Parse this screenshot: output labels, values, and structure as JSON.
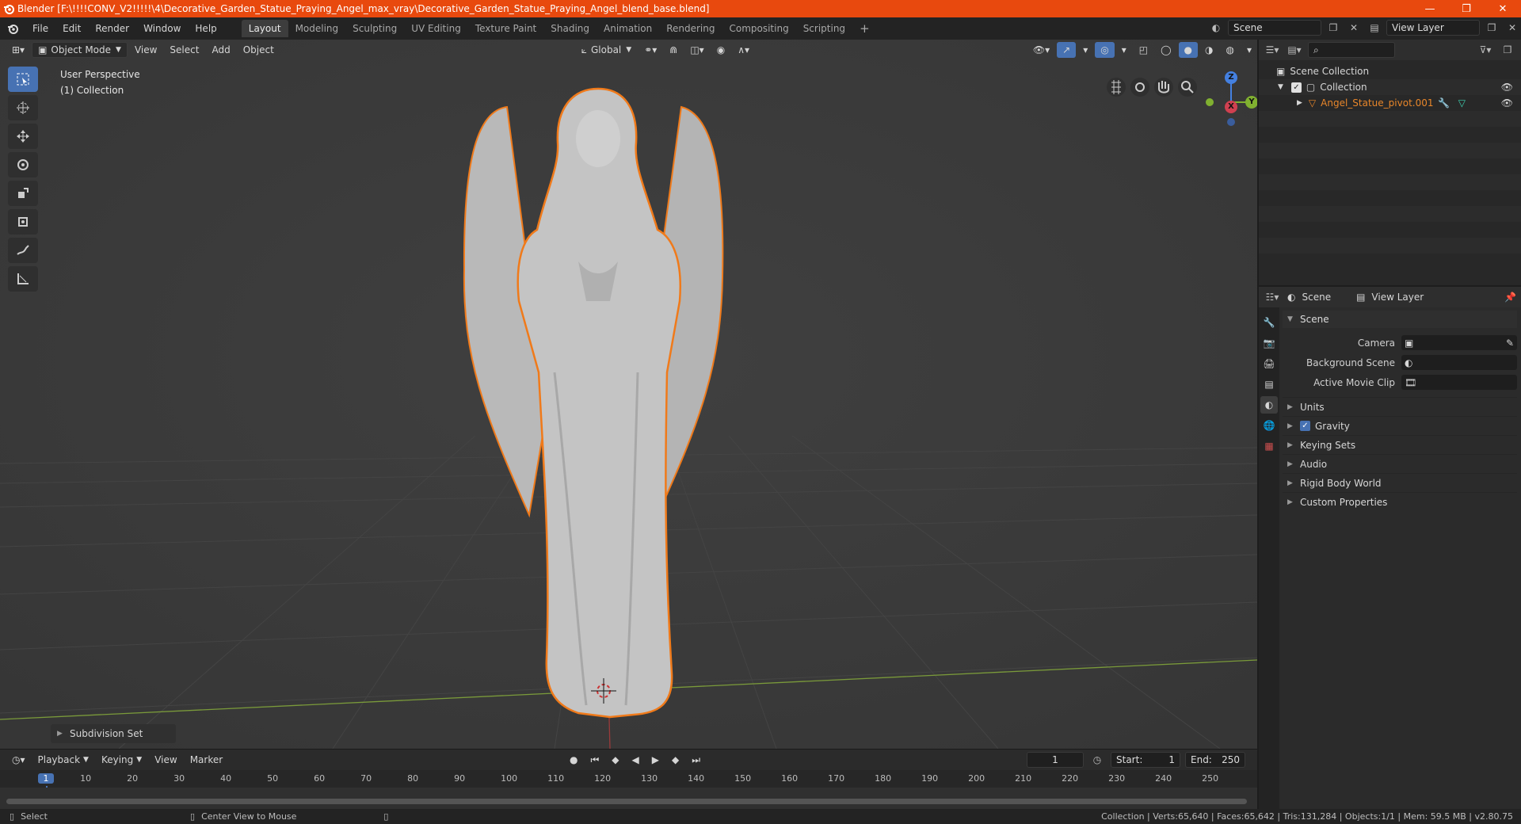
{
  "window": {
    "title": "Blender [F:\\!!!!CONV_V2!!!!!\\4\\Decorative_Garden_Statue_Praying_Angel_max_vray\\Decorative_Garden_Statue_Praying_Angel_blend_base.blend]",
    "minimize": "—",
    "maximize": "❐",
    "close": "✕"
  },
  "menu": [
    "File",
    "Edit",
    "Render",
    "Window",
    "Help"
  ],
  "workspaces": [
    "Layout",
    "Modeling",
    "Sculpting",
    "UV Editing",
    "Texture Paint",
    "Shading",
    "Animation",
    "Rendering",
    "Compositing",
    "Scripting"
  ],
  "workspace_add": "+",
  "scene_selector": {
    "value": "Scene"
  },
  "view_layer_selector": {
    "value": "View Layer"
  },
  "viewport": {
    "mode": "Object Mode",
    "menus": [
      "View",
      "Select",
      "Add",
      "Object"
    ],
    "orientation": "Global",
    "info_line1": "User Perspective",
    "info_line2": "(1) Collection",
    "operator_panel": "Subdivision Set",
    "gizmo": {
      "z": "Z",
      "x": "X",
      "y": "Y"
    }
  },
  "timeline": {
    "menus": [
      "Playback",
      "Keying",
      "View",
      "Marker"
    ],
    "current_frame": "1",
    "start_label": "Start:",
    "start_value": "1",
    "end_label": "End:",
    "end_value": "250",
    "ruler": [
      "1",
      "10",
      "20",
      "30",
      "40",
      "50",
      "60",
      "70",
      "80",
      "90",
      "100",
      "110",
      "120",
      "130",
      "140",
      "150",
      "160",
      "170",
      "180",
      "190",
      "200",
      "210",
      "220",
      "230",
      "240",
      "250"
    ]
  },
  "statusbar": {
    "select": "Select",
    "center_view": "Center View to Mouse",
    "stats": "Collection | Verts:65,640 | Faces:65,642 | Tris:131,284 | Objects:1/1 | Mem: 59.5 MB | v2.80.75"
  },
  "outliner": {
    "search_placeholder": "",
    "scene_collection": "Scene Collection",
    "collection": "Collection",
    "object": "Angel_Statue_pivot.001",
    "object_color": "#e8862a"
  },
  "properties": {
    "header_scene": "Scene",
    "header_view_layer": "View Layer",
    "panel_title": "Scene",
    "camera_label": "Camera",
    "background_scene_label": "Background Scene",
    "active_movie_clip_label": "Active Movie Clip",
    "subpanels": [
      "Units",
      "Gravity",
      "Keying Sets",
      "Audio",
      "Rigid Body World",
      "Custom Properties"
    ]
  },
  "colors": {
    "accent": "#4772b3",
    "title_bar": "#e8490e",
    "selection_outline": "#f07a1a"
  }
}
